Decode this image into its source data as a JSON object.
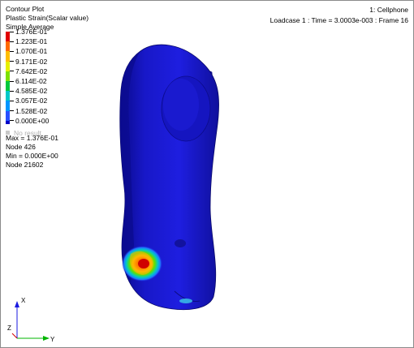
{
  "plot": {
    "title": "Contour Plot",
    "result_type": "Plastic Strain(Scalar value)",
    "averaging": "Simple Average"
  },
  "legend": {
    "entries": [
      {
        "label": "1.376E-01",
        "color": "#e10000"
      },
      {
        "label": "1.223E-01",
        "color": "#ff6a00"
      },
      {
        "label": "1.070E-01",
        "color": "#ffbe00"
      },
      {
        "label": "9.171E-02",
        "color": "#e6f000"
      },
      {
        "label": "7.642E-02",
        "color": "#7de000"
      },
      {
        "label": "6.114E-02",
        "color": "#00c83c"
      },
      {
        "label": "4.585E-02",
        "color": "#00c8c8"
      },
      {
        "label": "3.057E-02",
        "color": "#0096ff"
      },
      {
        "label": "1.528E-02",
        "color": "#2850ff"
      },
      {
        "label": "0.000E+00",
        "color": "#0000c8"
      }
    ],
    "no_result_label": "No result"
  },
  "stats": {
    "max": "Max = 1.376E-01",
    "max_node": "Node 426",
    "min": "Min = 0.000E+00",
    "min_node": "Node 21602"
  },
  "header_right": {
    "model_name": "1: Cellphone",
    "loadcase_info": "Loadcase 1 : Time = 3.0003e-003 : Frame 16"
  },
  "triad": {
    "x_label": "X",
    "y_label": "Y",
    "z_label": "Z"
  },
  "colors": {
    "model_base": "#1a1ad2",
    "background": "#ffffff"
  }
}
